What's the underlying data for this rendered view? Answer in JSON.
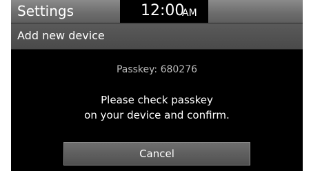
{
  "status_bar": {
    "title": "Settings",
    "clock_time": "12:00",
    "clock_ampm": "AM"
  },
  "header": {
    "title": "Add new device"
  },
  "dialog": {
    "passkey": "Passkey: 680276",
    "message_line1": "Please check passkey",
    "message_line2": "on your device and confirm.",
    "cancel_label": "Cancel"
  }
}
